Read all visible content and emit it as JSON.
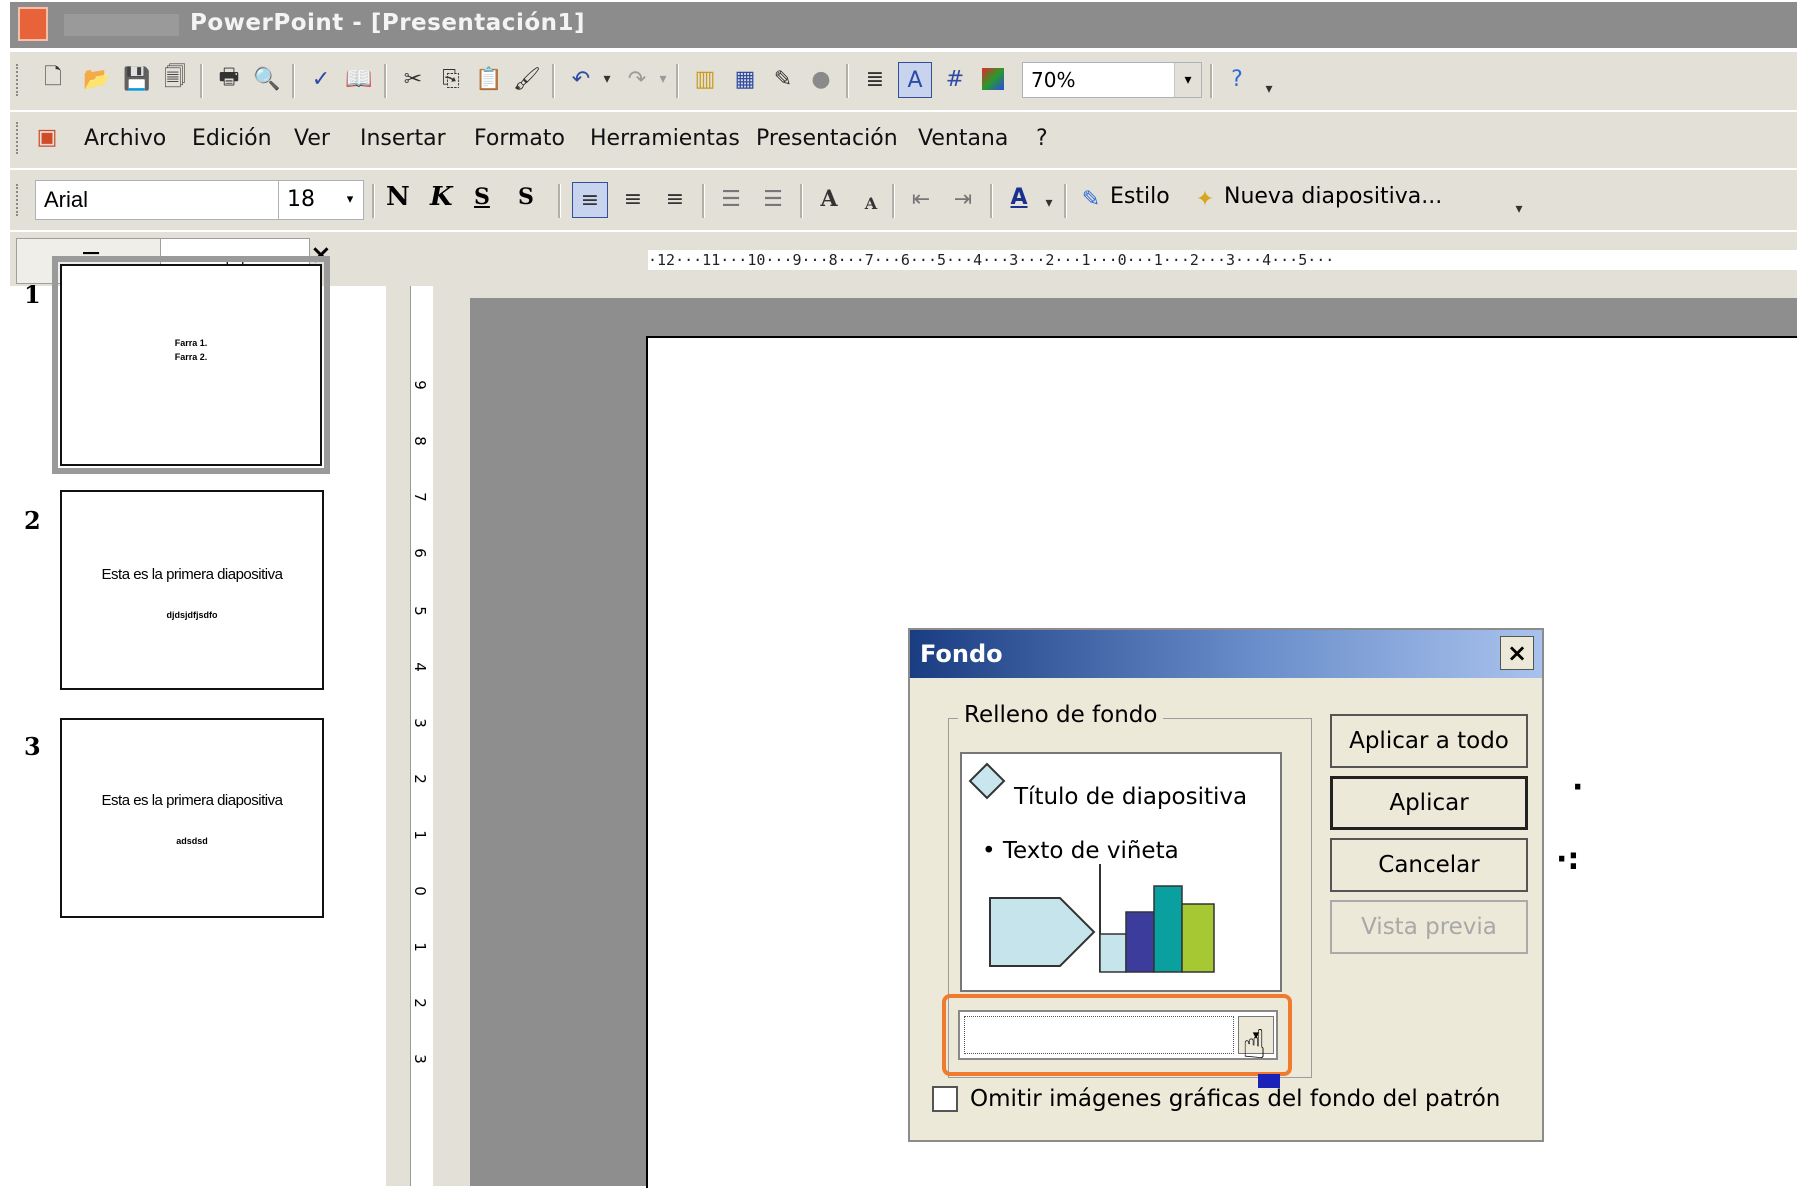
{
  "window": {
    "title": "PowerPoint - [Presentación1]"
  },
  "toolbar_standard": {
    "zoom_value": "70%",
    "icons": [
      "new-icon",
      "open-icon",
      "save-icon",
      "permission-icon",
      "print-icon",
      "print-preview-icon",
      "spelling-icon",
      "research-icon",
      "cut-icon",
      "copy-icon",
      "paste-icon",
      "format-painter-icon",
      "undo-icon",
      "redo-icon",
      "insert-chart-icon",
      "insert-table-icon",
      "tables-borders-icon",
      "insert-hyperlink-icon",
      "expand-icon",
      "show-formatting-icon",
      "grid-icon",
      "color-grayscale-icon",
      "help-icon"
    ]
  },
  "menu": {
    "items": [
      "Archivo",
      "Edición",
      "Ver",
      "Insertar",
      "Formato",
      "Herramientas",
      "Presentación",
      "Ventana",
      "?"
    ]
  },
  "toolbar_formatting": {
    "font": "Arial",
    "size": "18",
    "bold": "N",
    "italic": "K",
    "underline": "S",
    "shadow": "S",
    "font_color_label": "A",
    "style_label": "Estilo",
    "new_slide_label": "Nueva diapositiva..."
  },
  "left_pane": {
    "close": "×",
    "slides": [
      {
        "number": "1",
        "line1": "Farra 1.",
        "line2": "Farra 2."
      },
      {
        "number": "2",
        "line1": "Esta es la primera diapositiva",
        "line2": "djdsjdfjsdfo"
      },
      {
        "number": "3",
        "line1": "Esta es la primera diapositiva",
        "line2": "adsdsd"
      }
    ]
  },
  "ruler": {
    "horizontal": "·12···11···10···9···8···7···6···5···4···3···2···1···0···1···2···3···4···5···",
    "vertical_labels": [
      "9",
      "8",
      "7",
      "6",
      "5",
      "4",
      "3",
      "2",
      "1",
      "0",
      "1",
      "2",
      "3"
    ]
  },
  "dialog": {
    "title": "Fondo",
    "close": "×",
    "group_label": "Relleno de fondo",
    "preview_title": "Título de diapositiva",
    "preview_bullet": "Texto de viñeta",
    "buttons": {
      "apply_all": "Aplicar a todo",
      "apply": "Aplicar",
      "cancel": "Cancelar",
      "preview": "Vista previa"
    },
    "checkbox_label": "Omitir imágenes gráficas del fondo del patrón",
    "checkbox_checked": false
  }
}
